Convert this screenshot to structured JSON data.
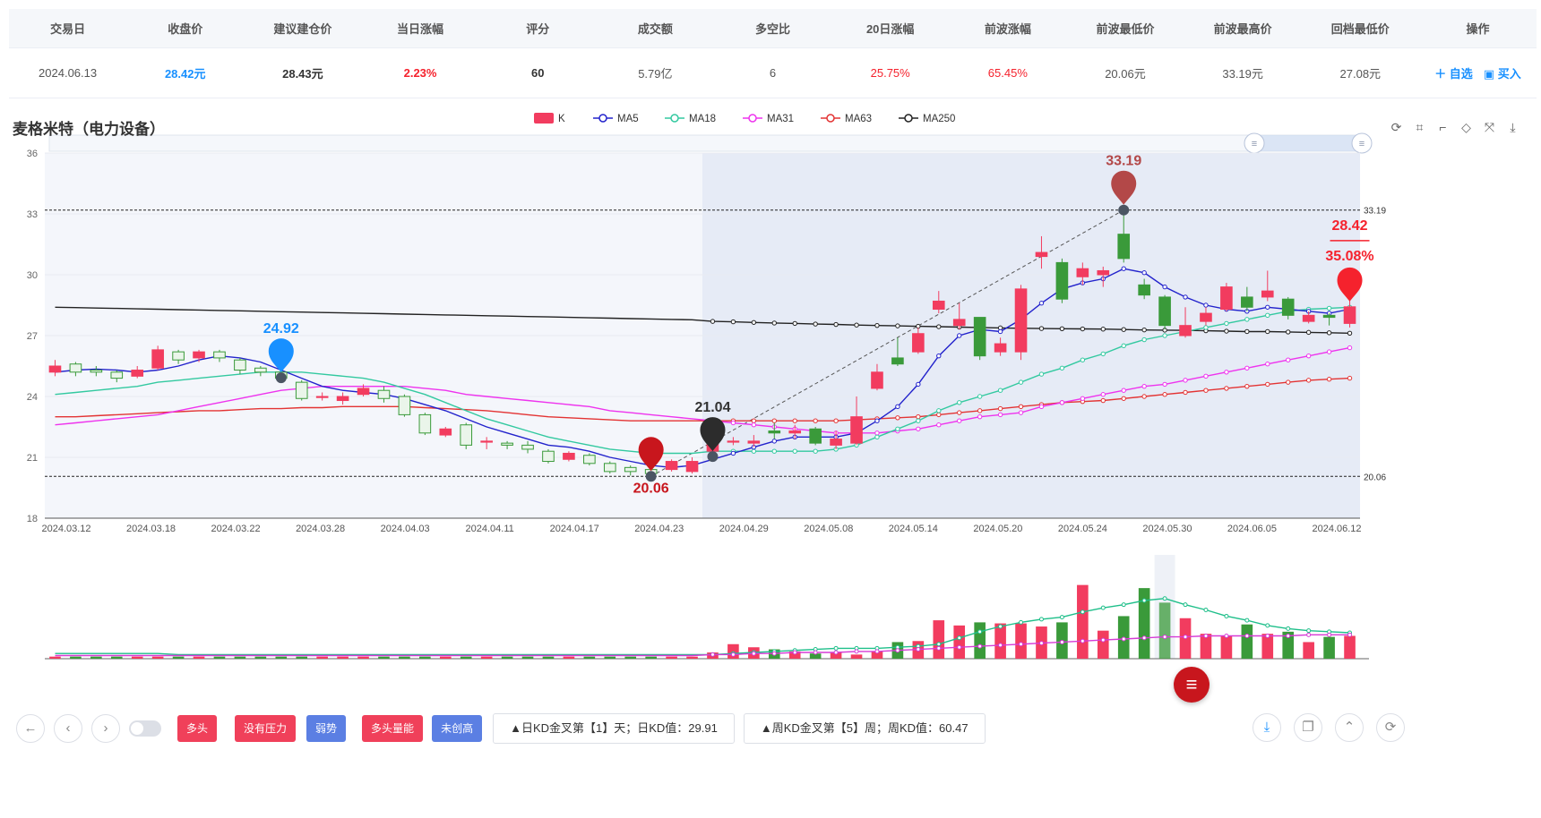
{
  "table": {
    "headers": [
      "交易日",
      "收盘价",
      "建议建仓价",
      "当日涨幅",
      "评分",
      "成交额",
      "多空比",
      "20日涨幅",
      "前波涨幅",
      "前波最低价",
      "前波最高价",
      "回档最低价",
      "操作"
    ],
    "row": {
      "date": "2024.06.13",
      "close": "28.42元",
      "suggest": "28.43元",
      "daily": "2.23%",
      "score": "60",
      "amount": "5.79亿",
      "ratio": "6",
      "d20": "25.75%",
      "wave": "65.45%",
      "wave_low": "20.06元",
      "wave_high": "33.19元",
      "pullback_low": "27.08元"
    },
    "ops": {
      "watch": "＋ 自选",
      "buy": "▣ 买入"
    }
  },
  "chart_title": "麦格米特（电力设备）",
  "toolbox_icons": [
    "restore-icon",
    "zoom-icon",
    "zoom-reset-icon",
    "data-view-icon",
    "fullscreen-icon",
    "download-icon"
  ],
  "chart_data": {
    "type": "candlestick",
    "ylim": [
      18,
      36
    ],
    "yticks": [
      18,
      21,
      24,
      27,
      30,
      33,
      36
    ],
    "x_labels": [
      "2024.03.12",
      "2024.03.18",
      "2024.03.22",
      "2024.03.28",
      "2024.04.03",
      "2024.04.11",
      "2024.04.17",
      "2024.04.23",
      "2024.04.29",
      "2024.05.08",
      "2024.05.14",
      "2024.05.20",
      "2024.05.24",
      "2024.05.30",
      "2024.06.05",
      "2024.06.12"
    ],
    "legend": [
      {
        "name": "K",
        "color": "#f23c5f",
        "kind": "box"
      },
      {
        "name": "MA5",
        "color": "#2222cc",
        "kind": "line"
      },
      {
        "name": "MA18",
        "color": "#33c9a0",
        "kind": "line"
      },
      {
        "name": "MA31",
        "color": "#ee33ee",
        "kind": "line"
      },
      {
        "name": "MA63",
        "color": "#e33333",
        "kind": "line"
      },
      {
        "name": "MA250",
        "color": "#222222",
        "kind": "line"
      }
    ],
    "candles": [
      [
        25.2,
        25.5,
        25.0,
        25.8
      ],
      [
        25.6,
        25.2,
        25.0,
        25.7
      ],
      [
        25.3,
        25.2,
        25.0,
        25.5
      ],
      [
        25.2,
        24.9,
        24.7,
        25.3
      ],
      [
        25.0,
        25.3,
        24.9,
        25.5
      ],
      [
        25.4,
        26.3,
        25.3,
        26.5
      ],
      [
        26.2,
        25.8,
        25.6,
        26.3
      ],
      [
        25.9,
        26.2,
        25.7,
        26.3
      ],
      [
        26.2,
        25.9,
        25.7,
        26.3
      ],
      [
        25.8,
        25.3,
        25.1,
        25.9
      ],
      [
        25.4,
        25.2,
        25.0,
        25.5
      ],
      [
        25.2,
        24.9,
        24.7,
        25.3
      ],
      [
        24.7,
        23.9,
        23.8,
        24.8
      ],
      [
        24.0,
        24.0,
        23.8,
        24.2
      ],
      [
        23.8,
        24.0,
        23.6,
        24.2
      ],
      [
        24.1,
        24.4,
        24.0,
        24.6
      ],
      [
        24.3,
        23.9,
        23.7,
        24.5
      ],
      [
        24.0,
        23.1,
        23.0,
        24.1
      ],
      [
        23.1,
        22.2,
        22.1,
        23.2
      ],
      [
        22.1,
        22.4,
        22.0,
        22.5
      ],
      [
        22.6,
        21.6,
        21.4,
        22.7
      ],
      [
        21.8,
        21.8,
        21.4,
        22.0
      ],
      [
        21.7,
        21.6,
        21.4,
        21.8
      ],
      [
        21.6,
        21.4,
        21.2,
        21.8
      ],
      [
        21.3,
        20.8,
        20.7,
        21.4
      ],
      [
        20.9,
        21.2,
        20.8,
        21.3
      ],
      [
        21.1,
        20.7,
        20.6,
        21.2
      ],
      [
        20.7,
        20.3,
        20.2,
        20.8
      ],
      [
        20.5,
        20.3,
        20.1,
        20.6
      ],
      [
        20.4,
        20.2,
        20.0,
        20.6
      ],
      [
        20.4,
        20.8,
        20.3,
        20.9
      ],
      [
        20.3,
        20.8,
        20.2,
        21.0
      ],
      [
        21.3,
        21.7,
        21.2,
        22.0
      ],
      [
        21.8,
        21.8,
        21.6,
        22.0
      ],
      [
        21.7,
        21.8,
        21.5,
        22.1
      ],
      [
        22.3,
        22.2,
        21.9,
        22.7
      ],
      [
        22.2,
        22.3,
        21.9,
        22.6
      ],
      [
        22.4,
        21.7,
        21.6,
        22.5
      ],
      [
        21.6,
        21.9,
        21.4,
        22.3
      ],
      [
        21.7,
        23.0,
        21.6,
        24.0
      ],
      [
        24.4,
        25.2,
        24.3,
        25.6
      ],
      [
        25.9,
        25.6,
        25.5,
        26.9
      ],
      [
        26.2,
        27.1,
        26.1,
        27.4
      ],
      [
        28.3,
        28.7,
        28.1,
        29.2
      ],
      [
        27.5,
        27.8,
        27.3,
        28.6
      ],
      [
        27.9,
        26.0,
        25.8,
        27.9
      ],
      [
        26.2,
        26.6,
        26.0,
        26.9
      ],
      [
        26.2,
        29.3,
        25.8,
        29.5
      ],
      [
        30.9,
        31.1,
        30.3,
        31.9
      ],
      [
        30.6,
        28.8,
        28.6,
        30.8
      ],
      [
        29.9,
        30.3,
        29.5,
        30.6
      ],
      [
        30.0,
        30.2,
        29.4,
        30.4
      ],
      [
        32.0,
        30.8,
        30.6,
        33.19
      ],
      [
        29.5,
        29.0,
        28.8,
        29.8
      ],
      [
        28.9,
        27.5,
        27.3,
        29.0
      ],
      [
        27.0,
        27.5,
        26.9,
        28.4
      ],
      [
        27.7,
        28.1,
        27.5,
        28.4
      ],
      [
        28.3,
        29.4,
        28.2,
        29.6
      ],
      [
        28.9,
        28.4,
        28.2,
        29.4
      ],
      [
        28.9,
        29.2,
        28.7,
        30.2
      ],
      [
        28.8,
        28.0,
        27.8,
        28.9
      ],
      [
        27.7,
        28.0,
        27.6,
        28.2
      ],
      [
        28.0,
        27.9,
        27.5,
        28.1
      ],
      [
        27.6,
        28.42,
        27.4,
        29.0
      ]
    ],
    "ma5": [
      25.2,
      25.3,
      25.35,
      25.3,
      25.2,
      25.3,
      25.5,
      25.8,
      26.0,
      25.9,
      25.7,
      25.3,
      24.9,
      24.5,
      24.3,
      24.2,
      24.1,
      23.9,
      23.6,
      23.3,
      22.9,
      22.5,
      22.2,
      21.9,
      21.6,
      21.5,
      21.3,
      21.0,
      20.8,
      20.6,
      20.5,
      20.6,
      20.9,
      21.2,
      21.5,
      21.8,
      22.0,
      22.0,
      22.0,
      22.2,
      22.8,
      23.5,
      24.6,
      26.0,
      27.0,
      27.3,
      27.2,
      27.8,
      28.6,
      29.3,
      29.6,
      29.8,
      30.3,
      30.1,
      29.4,
      28.9,
      28.5,
      28.3,
      28.2,
      28.4,
      28.3,
      28.2,
      28.1,
      28.3
    ],
    "ma18": [
      24.1,
      24.2,
      24.3,
      24.4,
      24.5,
      24.7,
      24.8,
      24.9,
      25.0,
      25.1,
      25.2,
      25.2,
      25.2,
      25.1,
      25.0,
      24.9,
      24.7,
      24.4,
      24.1,
      23.7,
      23.3,
      22.9,
      22.6,
      22.3,
      22.0,
      21.8,
      21.6,
      21.4,
      21.3,
      21.2,
      21.2,
      21.2,
      21.3,
      21.3,
      21.3,
      21.3,
      21.3,
      21.3,
      21.4,
      21.6,
      22.0,
      22.4,
      22.8,
      23.3,
      23.7,
      24.0,
      24.3,
      24.7,
      25.1,
      25.4,
      25.8,
      26.1,
      26.5,
      26.8,
      27.0,
      27.2,
      27.4,
      27.6,
      27.8,
      28.0,
      28.2,
      28.3,
      28.35,
      28.4
    ],
    "ma31": [
      22.6,
      22.7,
      22.8,
      22.9,
      23.0,
      23.1,
      23.3,
      23.5,
      23.7,
      23.9,
      24.1,
      24.3,
      24.4,
      24.5,
      24.5,
      24.5,
      24.5,
      24.5,
      24.4,
      24.3,
      24.1,
      24.0,
      23.9,
      23.8,
      23.7,
      23.6,
      23.5,
      23.3,
      23.2,
      23.1,
      23.0,
      22.9,
      22.8,
      22.7,
      22.6,
      22.5,
      22.4,
      22.3,
      22.2,
      22.2,
      22.2,
      22.3,
      22.4,
      22.6,
      22.8,
      23.0,
      23.1,
      23.2,
      23.5,
      23.7,
      23.9,
      24.1,
      24.3,
      24.5,
      24.6,
      24.8,
      25.0,
      25.2,
      25.4,
      25.6,
      25.8,
      26.0,
      26.2,
      26.4
    ],
    "ma63": [
      23.0,
      23.0,
      23.05,
      23.1,
      23.15,
      23.2,
      23.25,
      23.3,
      23.3,
      23.35,
      23.4,
      23.4,
      23.45,
      23.45,
      23.5,
      23.5,
      23.5,
      23.5,
      23.45,
      23.4,
      23.35,
      23.3,
      23.2,
      23.1,
      23.0,
      22.95,
      22.9,
      22.85,
      22.8,
      22.8,
      22.8,
      22.8,
      22.8,
      22.8,
      22.8,
      22.8,
      22.8,
      22.8,
      22.8,
      22.85,
      22.9,
      22.95,
      23.0,
      23.1,
      23.2,
      23.3,
      23.4,
      23.5,
      23.6,
      23.7,
      23.75,
      23.8,
      23.9,
      24.0,
      24.1,
      24.2,
      24.3,
      24.4,
      24.5,
      24.6,
      24.7,
      24.8,
      24.85,
      24.9
    ],
    "ma250": [
      28.4,
      28.38,
      28.36,
      28.34,
      28.32,
      28.3,
      28.28,
      28.26,
      28.24,
      28.22,
      28.2,
      28.18,
      28.16,
      28.14,
      28.12,
      28.1,
      28.08,
      28.06,
      28.04,
      28.02,
      28.0,
      27.98,
      27.96,
      27.94,
      27.92,
      27.9,
      27.88,
      27.86,
      27.84,
      27.82,
      27.8,
      27.78,
      27.7,
      27.68,
      27.65,
      27.62,
      27.6,
      27.57,
      27.55,
      27.52,
      27.5,
      27.48,
      27.46,
      27.44,
      27.42,
      27.4,
      27.38,
      27.36,
      27.35,
      27.34,
      27.33,
      27.32,
      27.3,
      27.28,
      27.27,
      27.26,
      27.24,
      27.22,
      27.2,
      27.2,
      27.18,
      27.16,
      27.14,
      27.12
    ],
    "volume_max": 100,
    "volume": [
      2,
      2,
      2,
      2,
      2,
      2,
      2,
      2,
      2,
      2,
      2,
      2,
      2,
      2,
      2,
      2,
      2,
      2,
      2,
      2,
      2,
      2,
      2,
      2,
      2,
      2,
      2,
      2,
      2,
      2,
      2,
      2,
      6,
      14,
      11,
      9,
      7,
      5,
      6,
      4,
      7,
      16,
      17,
      37,
      32,
      35,
      34,
      34,
      31,
      35,
      71,
      27,
      41,
      68,
      54,
      39,
      24,
      22,
      33,
      24,
      26,
      16,
      21,
      22
    ],
    "vol_ma_green": [
      5,
      5,
      5,
      5,
      5,
      5,
      4,
      4,
      4,
      4,
      4,
      4,
      4,
      4,
      4,
      4,
      4,
      4,
      4,
      4,
      4,
      4,
      4,
      4,
      4,
      4,
      4,
      4,
      4,
      4,
      4,
      4,
      4,
      5,
      6,
      7,
      8,
      9,
      10,
      10,
      10,
      11,
      12,
      14,
      20,
      26,
      31,
      35,
      38,
      40,
      45,
      49,
      52,
      56,
      58,
      52,
      47,
      41,
      37,
      32,
      29,
      27,
      26,
      25
    ],
    "vol_ma_purple": [
      3,
      3,
      3,
      3,
      3,
      3,
      3,
      3,
      3,
      3,
      3,
      3,
      3,
      3,
      3,
      3,
      3,
      3,
      3,
      3,
      3,
      3,
      3,
      3,
      3,
      3,
      3,
      3,
      3,
      3,
      3,
      3,
      4,
      4,
      5,
      5,
      6,
      6,
      6,
      7,
      7,
      8,
      9,
      10,
      11,
      12,
      13,
      14,
      15,
      16,
      17,
      18,
      19,
      20,
      21,
      21,
      22,
      22,
      22,
      22,
      22,
      23,
      23,
      23
    ],
    "ref_lines": {
      "high": 33.19,
      "low": 20.06
    },
    "markers": [
      {
        "label": "24.92",
        "value": 24.92,
        "index": 11,
        "color": "#1890ff"
      },
      {
        "label": "20.06",
        "value": 20.06,
        "index": 29,
        "color": "#c8161d"
      },
      {
        "label": "21.04",
        "value": 21.04,
        "index": 32,
        "color": "#2c2c2c"
      },
      {
        "label": "33.19",
        "value": 33.19,
        "index": 52,
        "color": "#b34848"
      },
      {
        "label": "28.42",
        "value": 28.42,
        "index": 63,
        "color": "#f5222d"
      }
    ],
    "change_label": "35.08%",
    "highlight_start_index": 32
  },
  "bottom": {
    "tags": [
      {
        "label": "多头",
        "color": "red"
      },
      {
        "label": "没有压力",
        "color": "red"
      },
      {
        "label": "弱势",
        "color": "blue"
      },
      {
        "label": "多头量能",
        "color": "red"
      },
      {
        "label": "未创高",
        "color": "blue"
      }
    ],
    "kd_day": "▲日KD金叉第【1】天；日KD值：29.91",
    "kd_week": "▲周KD金叉第【5】周；周KD值：60.47"
  },
  "fab_icon": "≡"
}
